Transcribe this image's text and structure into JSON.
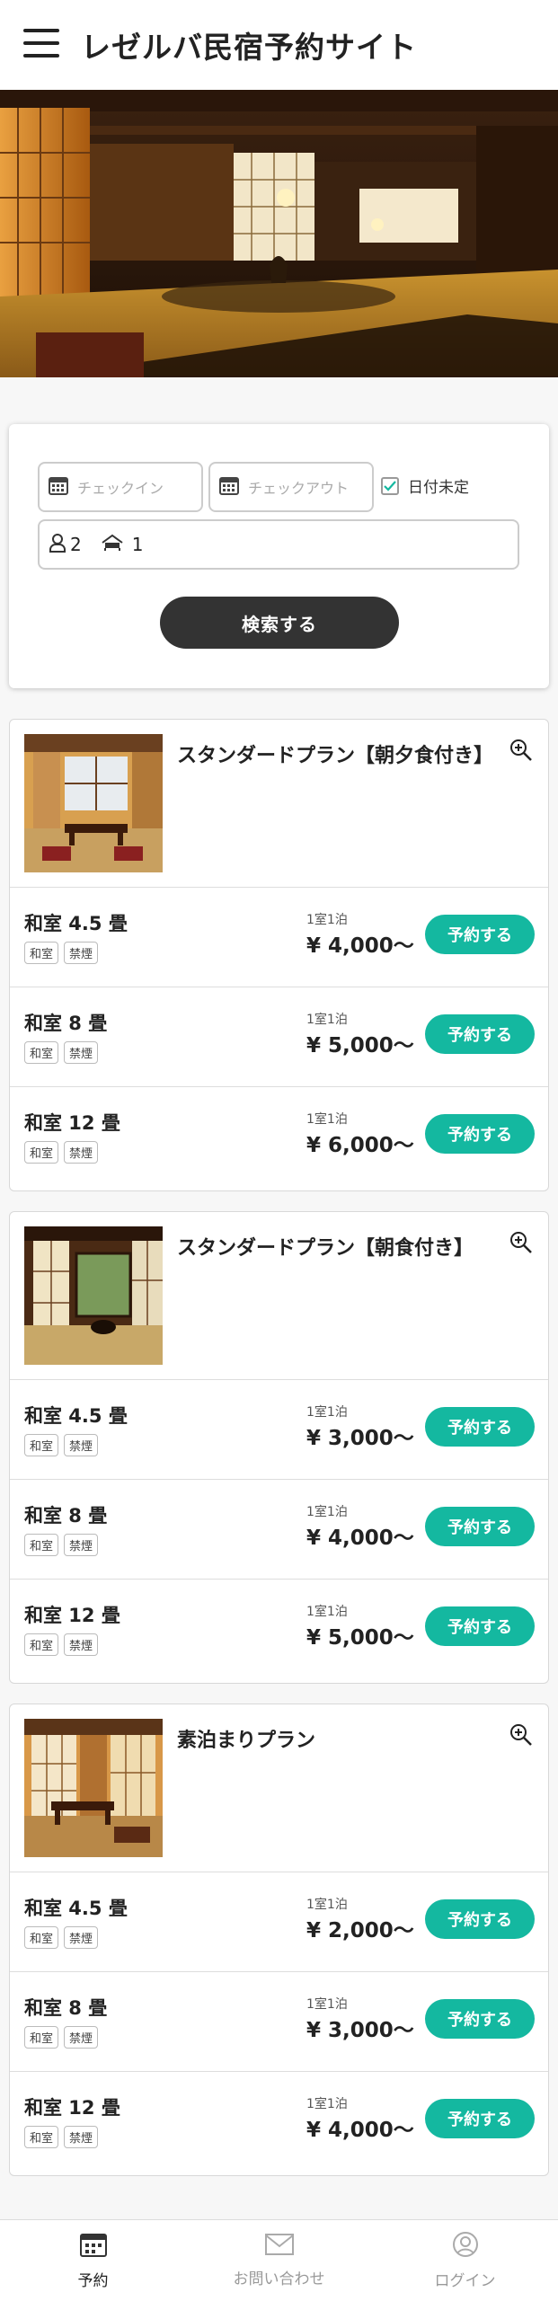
{
  "header": {
    "title": "レゼルバ民宿予約サイト",
    "menu_icon": "hamburger-icon"
  },
  "hero": {
    "image": "japanese-inn-interior-photo"
  },
  "search": {
    "checkin_placeholder": "チェックイン",
    "checkout_placeholder": "チェックアウト",
    "date_undecided_label": "日付未定",
    "date_undecided_checked": true,
    "adults": "2",
    "rooms": "1",
    "search_button": "検索する"
  },
  "plans": [
    {
      "name": "スタンダードプラン【朝夕食付き】",
      "rooms": [
        {
          "name": "和室 4.5 畳",
          "tags": [
            "和室",
            "禁煙"
          ],
          "rate_label": "1室1泊",
          "price": "¥ 4,000〜",
          "button": "予約する"
        },
        {
          "name": "和室 8 畳",
          "tags": [
            "和室",
            "禁煙"
          ],
          "rate_label": "1室1泊",
          "price": "¥ 5,000〜",
          "button": "予約する"
        },
        {
          "name": "和室 12 畳",
          "tags": [
            "和室",
            "禁煙"
          ],
          "rate_label": "1室1泊",
          "price": "¥ 6,000〜",
          "button": "予約する"
        }
      ]
    },
    {
      "name": "スタンダードプラン【朝食付き】",
      "rooms": [
        {
          "name": "和室 4.5 畳",
          "tags": [
            "和室",
            "禁煙"
          ],
          "rate_label": "1室1泊",
          "price": "¥ 3,000〜",
          "button": "予約する"
        },
        {
          "name": "和室 8 畳",
          "tags": [
            "和室",
            "禁煙"
          ],
          "rate_label": "1室1泊",
          "price": "¥ 4,000〜",
          "button": "予約する"
        },
        {
          "name": "和室 12 畳",
          "tags": [
            "和室",
            "禁煙"
          ],
          "rate_label": "1室1泊",
          "price": "¥ 5,000〜",
          "button": "予約する"
        }
      ]
    },
    {
      "name": "素泊まりプラン",
      "rooms": [
        {
          "name": "和室 4.5 畳",
          "tags": [
            "和室",
            "禁煙"
          ],
          "rate_label": "1室1泊",
          "price": "¥ 2,000〜",
          "button": "予約する"
        },
        {
          "name": "和室 8 畳",
          "tags": [
            "和室",
            "禁煙"
          ],
          "rate_label": "1室1泊",
          "price": "¥ 3,000〜",
          "button": "予約する"
        },
        {
          "name": "和室 12 畳",
          "tags": [
            "和室",
            "禁煙"
          ],
          "rate_label": "1室1泊",
          "price": "¥ 4,000〜",
          "button": "予約する"
        }
      ]
    }
  ],
  "bottom_nav": [
    {
      "label": "予約",
      "icon": "calendar-icon",
      "active": true
    },
    {
      "label": "お問い合わせ",
      "icon": "mail-icon",
      "active": false
    },
    {
      "label": "ログイン",
      "icon": "user-icon",
      "active": false
    }
  ],
  "colors": {
    "accent": "#14b8a0",
    "dark_button": "#333333",
    "inactive_nav": "#9a9a9a"
  }
}
